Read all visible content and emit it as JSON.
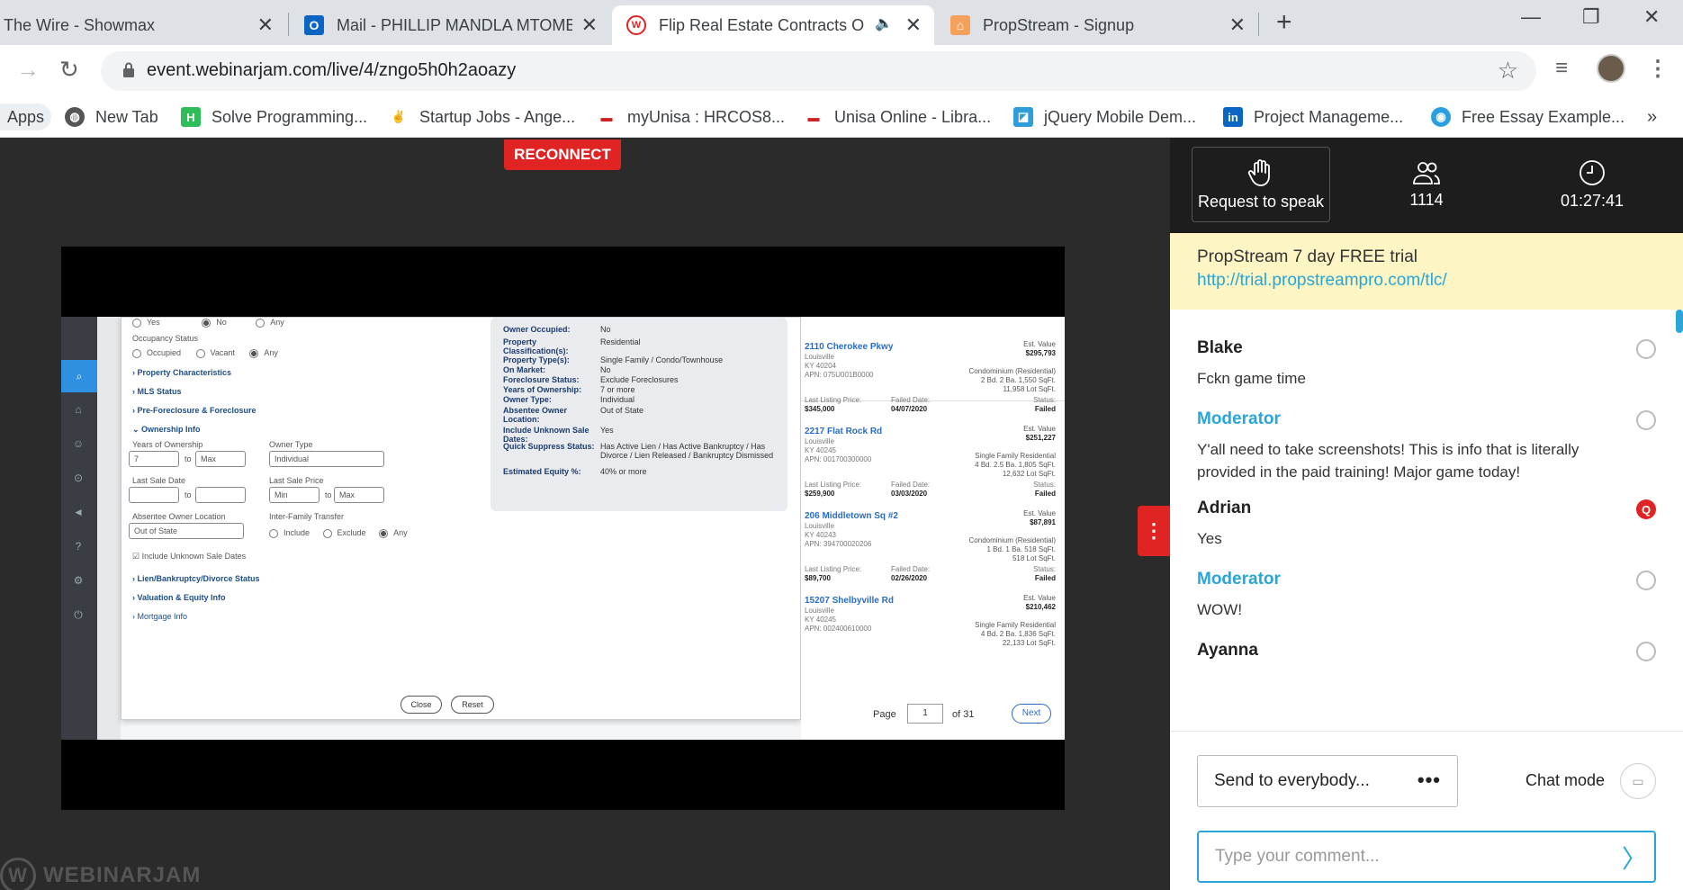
{
  "browser": {
    "tabs": [
      {
        "title": "The Wire - Showmax",
        "icon": "showmax-icon"
      },
      {
        "title": "Mail - PHILLIP MANDLA MTOMB",
        "icon": "outlook-icon"
      },
      {
        "title": "Flip Real Estate Contracts Of",
        "icon": "webinarjam-icon",
        "active": true
      },
      {
        "title": "PropStream - Signup",
        "icon": "propstream-icon"
      }
    ],
    "url": "event.webinarjam.com/live/4/zngo5h0h2aoazy",
    "bookmarks": [
      {
        "label": "Apps"
      },
      {
        "label": "New Tab"
      },
      {
        "label": "Solve Programming..."
      },
      {
        "label": "Startup Jobs - Ange..."
      },
      {
        "label": "myUnisa : HRCOS8..."
      },
      {
        "label": "Unisa Online - Libra..."
      },
      {
        "label": "jQuery Mobile Dem..."
      },
      {
        "label": "Project Manageme..."
      },
      {
        "label": "Free Essay Example..."
      }
    ]
  },
  "stage": {
    "reconnect_label": "RECONNECT",
    "watermark": "WEBINARJAM"
  },
  "shared_screen": {
    "filters": {
      "row_top": [
        "Yes",
        "No",
        "Any"
      ],
      "occupancy_label": "Occupancy Status",
      "occupancy_options": [
        "Occupied",
        "Vacant",
        "Any"
      ],
      "sections": [
        "Property Characteristics",
        "MLS Status",
        "Pre-Foreclosure & Foreclosure",
        "Ownership Info"
      ],
      "years_label": "Years of Ownership",
      "years_from": "7",
      "years_to": "Max",
      "to_label": "to",
      "owner_type_label": "Owner Type",
      "owner_type_value": "Individual",
      "last_sale_date_label": "Last Sale Date",
      "last_sale_price_label": "Last Sale Price",
      "price_min": "Min",
      "price_max": "Max",
      "absentee_label": "Absentee Owner Location",
      "absentee_value": "Out of State",
      "interfamily_label": "Inter-Family Transfer",
      "interfamily_options": [
        "Include",
        "Exclude",
        "Any"
      ],
      "include_unknown": "Include Unknown Sale Dates",
      "more_sections": [
        "Lien/Bankruptcy/Divorce Status",
        "Valuation & Equity Info",
        "Mortgage Info"
      ],
      "close_btn": "Close",
      "reset_btn": "Reset"
    },
    "summary": [
      {
        "k": "Owner Occupied:",
        "v": "No"
      },
      {
        "k": "Property Classification(s):",
        "v": "Residential"
      },
      {
        "k": "Property Type(s):",
        "v": "Single Family / Condo/Townhouse"
      },
      {
        "k": "On Market:",
        "v": "No"
      },
      {
        "k": "Foreclosure Status:",
        "v": "Exclude Foreclosures"
      },
      {
        "k": "Years of Ownership:",
        "v": "7 or more"
      },
      {
        "k": "Owner Type:",
        "v": "Individual"
      },
      {
        "k": "Absentee Owner Location:",
        "v": "Out of State"
      },
      {
        "k": "Include Unknown Sale Dates:",
        "v": "Yes"
      },
      {
        "k": "Quick Suppress Status:",
        "v": "Has Active Lien / Has Active Bankruptcy / Has Divorce / Lien Released / Bankruptcy Dismissed"
      },
      {
        "k": "Estimated Equity %:",
        "v": "40% or more"
      }
    ],
    "listings": [
      {
        "addr": "2110 Cherokee Pkwy",
        "city": "Louisville",
        "zip": "KY 40204",
        "apn": "APN: 075U001B0000",
        "est_label": "Est. Value",
        "est": "$295,793",
        "type": "Condominium (Residential)",
        "beds": "2 Bd.  2 Ba.  1,550 SqFt.",
        "lot": "11,958 Lot SqFt.",
        "lp_label": "Last Listing Price:",
        "lp": "$345,000",
        "fd_label": "Failed Date:",
        "fd": "04/07/2020",
        "st_label": "Status:",
        "st": "Failed"
      },
      {
        "addr": "2217 Flat Rock Rd",
        "city": "Louisville",
        "zip": "KY 40245",
        "apn": "APN: 001700300000",
        "est_label": "Est. Value",
        "est": "$251,227",
        "type": "Single Family Residential",
        "beds": "4 Bd.  2.5 Ba.  1,805 SqFt.",
        "lot": "12,632 Lot SqFt.",
        "lp_label": "Last Listing Price:",
        "lp": "$259,900",
        "fd_label": "Failed Date:",
        "fd": "03/03/2020",
        "st_label": "Status:",
        "st": "Failed"
      },
      {
        "addr": "206 Middletown Sq #2",
        "city": "Louisville",
        "zip": "KY 40243",
        "apn": "APN: 394700020206",
        "est_label": "Est. Value",
        "est": "$87,891",
        "type": "Condominium (Residential)",
        "beds": "1 Bd.  1 Ba.  518 SqFt.",
        "lot": "518 Lot SqFt.",
        "lp_label": "Last Listing Price:",
        "lp": "$89,700",
        "fd_label": "Failed Date:",
        "fd": "02/26/2020",
        "st_label": "Status:",
        "st": "Failed"
      },
      {
        "addr": "15207 Shelbyville Rd",
        "city": "Louisville",
        "zip": "KY 40245",
        "apn": "APN: 002400610000",
        "est_label": "Est. Value",
        "est": "$210,462",
        "type": "Single Family Residential",
        "beds": "4 Bd.  2 Ba.  1,836 SqFt.",
        "lot": "22,133 Lot SqFt.",
        "lp_label": "",
        "lp": "",
        "fd_label": "",
        "fd": "",
        "st_label": "",
        "st": ""
      }
    ],
    "pager": {
      "page_label": "Page",
      "page": "1",
      "of": "of 31",
      "next": "Next",
      "last": "»"
    }
  },
  "panel": {
    "request_label": "Request to speak",
    "attendees": "1114",
    "timer": "01:27:41",
    "promo_title": "PropStream 7 day FREE trial",
    "promo_link": "http://trial.propstreampro.com/tlc/",
    "messages": [
      {
        "name": "Blake",
        "text": "Fckn game time",
        "moderator": false
      },
      {
        "name": "Moderator",
        "text": "Y'all need to take screenshots! This is info that is literally provided in the paid training! Major game today!",
        "moderator": true
      },
      {
        "name": "Adrian",
        "text": "Yes",
        "moderator": false,
        "question_badge": "Q"
      },
      {
        "name": "Moderator",
        "text": "WOW!",
        "moderator": true
      },
      {
        "name": "Ayanna",
        "text": "",
        "moderator": false
      }
    ],
    "send_to": "Send to everybody...",
    "chat_mode": "Chat mode",
    "comment_placeholder": "Type your comment..."
  }
}
